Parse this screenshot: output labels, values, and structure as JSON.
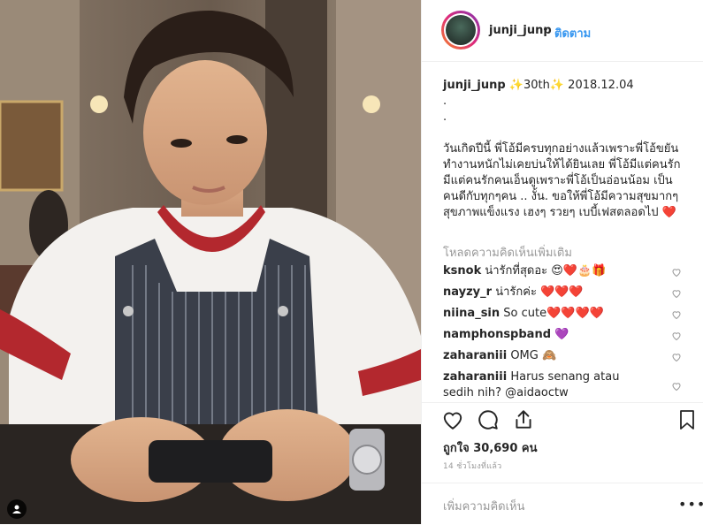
{
  "post": {
    "username": "junji_junp",
    "separator": "•",
    "follow_label": "ติดตาม",
    "caption": {
      "username": "junji_junp",
      "line1": "✨30th✨ 2018.12.04",
      "dot1": ".",
      "dot2": ".",
      "body": "วันเกิดปีนี้ พี่โอ้มีครบทุกอย่างแล้วเพราะพี่โอ้ขยันทำงานหนักไม่เคยบ่นให้ได้ยินเลย พี่โอ้มีแต่คนรัก มีแต่คนรักคนเอ็นดูเพราะพี่โอ้เป็นอ่อนน้อม เป็นคนดีกับทุกๆคน .. งั้น. ขอให้พี่โอ้มีความสุขมากๆ สุขภาพแข็งแรง เฮงๆ รวยๆ เบบี้เฟสตลอดไป ❤️"
    },
    "load_more": "โหลดความคิดเห็นเพิ่มเติม",
    "comments": [
      {
        "user": "ksnok",
        "text": "น่ารักที่สุดอะ 😍❤️🎂🎁"
      },
      {
        "user": "nayzy_r",
        "text": "น่ารักค่ะ ❤️❤️❤️"
      },
      {
        "user": "niina_sin",
        "text": "So cute❤️❤️❤️❤️"
      },
      {
        "user": "namphonspband",
        "text": "💜"
      },
      {
        "user": "zaharaniii",
        "text": "OMG 🙈"
      },
      {
        "user": "zaharaniii",
        "text": "Harus senang atau sedih nih? @aidaoctw"
      }
    ],
    "likes": "ถูกใจ 30,690 คน",
    "time_ago": "14 ชั่วโมงที่แล้ว",
    "add_comment_placeholder": "เพิ่มความคิดเห็น",
    "more_label": "•••"
  },
  "icons": {
    "like": "heart-outline-icon",
    "comment": "comment-bubble-icon",
    "share": "share-icon",
    "save": "bookmark-icon",
    "tag": "user-tag-icon"
  },
  "colors": {
    "accent": "#3897f0",
    "text": "#262626",
    "muted": "#999999",
    "heart": "#ed4956"
  }
}
